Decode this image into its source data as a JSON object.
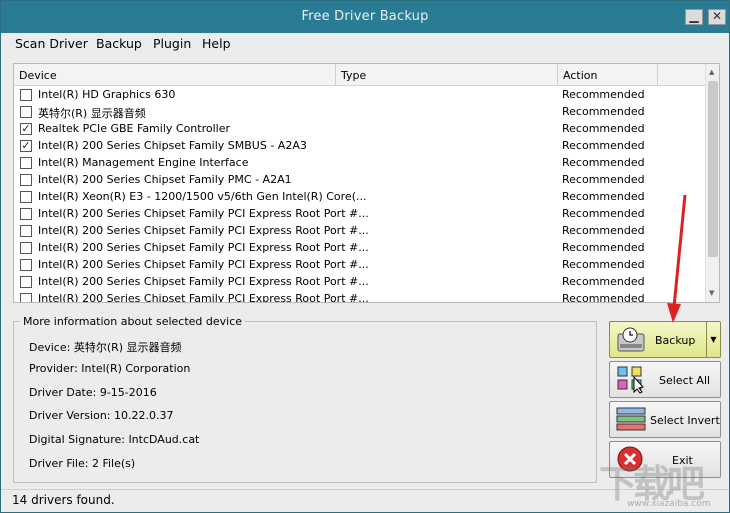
{
  "window": {
    "title": "Free Driver Backup",
    "min_glyph": "▁",
    "close_glyph": "✕"
  },
  "menu": [
    "Scan Driver",
    "Backup",
    "Plugin",
    "Help"
  ],
  "columns": [
    "Device",
    "Type",
    "Action"
  ],
  "devices": [
    {
      "name": "Intel(R) HD Graphics 630",
      "checked": false,
      "action": "Recommended"
    },
    {
      "name": "英特尔(R) 显示器音频",
      "checked": false,
      "action": "Recommended"
    },
    {
      "name": "Realtek PCIe GBE Family Controller",
      "checked": true,
      "action": "Recommended"
    },
    {
      "name": "Intel(R) 200 Series Chipset Family SMBUS - A2A3",
      "checked": true,
      "action": "Recommended"
    },
    {
      "name": "Intel(R) Management Engine Interface",
      "checked": false,
      "action": "Recommended"
    },
    {
      "name": "Intel(R) 200 Series Chipset Family PMC - A2A1",
      "checked": false,
      "action": "Recommended"
    },
    {
      "name": "Intel(R) Xeon(R) E3 - 1200/1500 v5/6th Gen Intel(R) Core(...",
      "checked": false,
      "action": "Recommended"
    },
    {
      "name": "Intel(R) 200 Series Chipset Family PCI Express Root Port #...",
      "checked": false,
      "action": "Recommended"
    },
    {
      "name": "Intel(R) 200 Series Chipset Family PCI Express Root Port #...",
      "checked": false,
      "action": "Recommended"
    },
    {
      "name": "Intel(R) 200 Series Chipset Family PCI Express Root Port #...",
      "checked": false,
      "action": "Recommended"
    },
    {
      "name": "Intel(R) 200 Series Chipset Family PCI Express Root Port #...",
      "checked": false,
      "action": "Recommended"
    },
    {
      "name": "Intel(R) 200 Series Chipset Family PCI Express Root Port #...",
      "checked": false,
      "action": "Recommended"
    },
    {
      "name": "Intel(R) 200 Series Chipset Family PCI Express Root Port #...",
      "checked": false,
      "action": "Recommended"
    }
  ],
  "info": {
    "legend": "More information about selected device",
    "device": "Device:  英特尔(R) 显示器音频",
    "provider": "Provider:  Intel(R) Corporation",
    "driver_date": "Driver Date:  9-15-2016",
    "driver_version": "Driver Version:  10.22.0.37",
    "digital_signature": "Digital Signature:  IntcDAud.cat",
    "driver_file": "Driver File:  2 File(s)"
  },
  "buttons": {
    "backup": "Backup",
    "select_all": "Select All",
    "select_invert": "Select Invert",
    "exit": "Exit"
  },
  "status": "14 drivers found.",
  "watermark": {
    "text": "下载吧",
    "url": "www.xiazaiba.com"
  },
  "colors": {
    "titlebar": "#2a7c95",
    "backup_button": "#dfe689",
    "arrow": "#e02020"
  }
}
